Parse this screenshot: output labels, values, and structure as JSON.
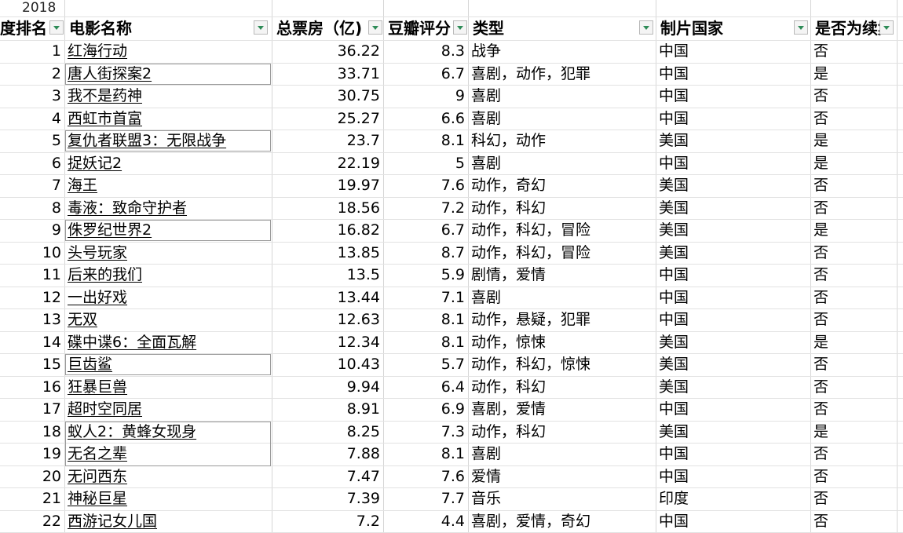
{
  "year_label": "2018",
  "headers": [
    "度排名",
    "电影名称",
    "总票房（亿)",
    "豆瓣评分",
    "类型",
    "制片国家",
    "是否为续集"
  ],
  "rows": [
    {
      "rank": "1",
      "name": "红海行动",
      "box_office": "36.22",
      "rating": "8.3",
      "genre": "战争",
      "country": "中国",
      "sequel": "否"
    },
    {
      "rank": "2",
      "name": "唐人街探案2",
      "box_office": "33.71",
      "rating": "6.7",
      "genre": "喜剧，动作，犯罪",
      "country": "中国",
      "sequel": "是"
    },
    {
      "rank": "3",
      "name": "我不是药神",
      "box_office": "30.75",
      "rating": "9",
      "genre": "喜剧",
      "country": "中国",
      "sequel": "否"
    },
    {
      "rank": "4",
      "name": "西虹市首富",
      "box_office": "25.27",
      "rating": "6.6",
      "genre": "喜剧",
      "country": "中国",
      "sequel": "否"
    },
    {
      "rank": "5",
      "name": "复仇者联盟3：无限战争",
      "box_office": "23.7",
      "rating": "8.1",
      "genre": "科幻，动作",
      "country": "美国",
      "sequel": "是"
    },
    {
      "rank": "6",
      "name": "捉妖记2",
      "box_office": "22.19",
      "rating": "5",
      "genre": "喜剧",
      "country": "中国",
      "sequel": "是"
    },
    {
      "rank": "7",
      "name": "海王",
      "box_office": "19.97",
      "rating": "7.6",
      "genre": "动作，奇幻",
      "country": "美国",
      "sequel": "否"
    },
    {
      "rank": "8",
      "name": "毒液：致命守护者",
      "box_office": "18.56",
      "rating": "7.2",
      "genre": "动作，科幻",
      "country": "美国",
      "sequel": "否"
    },
    {
      "rank": "9",
      "name": "侏罗纪世界2",
      "box_office": "16.82",
      "rating": "6.7",
      "genre": "动作，科幻，冒险",
      "country": "美国",
      "sequel": "是"
    },
    {
      "rank": "10",
      "name": "头号玩家",
      "box_office": "13.85",
      "rating": "8.7",
      "genre": "动作，科幻，冒险",
      "country": "美国",
      "sequel": "否"
    },
    {
      "rank": "11",
      "name": "后来的我们",
      "box_office": "13.5",
      "rating": "5.9",
      "genre": "剧情，爱情",
      "country": "中国",
      "sequel": "否"
    },
    {
      "rank": "12",
      "name": "一出好戏",
      "box_office": "13.44",
      "rating": "7.1",
      "genre": "喜剧",
      "country": "中国",
      "sequel": "否"
    },
    {
      "rank": "13",
      "name": "无双",
      "box_office": "12.63",
      "rating": "8.1",
      "genre": "动作，悬疑，犯罪",
      "country": "中国",
      "sequel": "否"
    },
    {
      "rank": "14",
      "name": "碟中谍6：全面瓦解",
      "box_office": "12.34",
      "rating": "8.1",
      "genre": "动作，惊悚",
      "country": "美国",
      "sequel": "是"
    },
    {
      "rank": "15",
      "name": "巨齿鲨",
      "box_office": "10.43",
      "rating": "5.7",
      "genre": "动作，科幻，惊悚",
      "country": "美国",
      "sequel": "否"
    },
    {
      "rank": "16",
      "name": "狂暴巨兽",
      "box_office": "9.94",
      "rating": "6.4",
      "genre": "动作，科幻",
      "country": "美国",
      "sequel": "否"
    },
    {
      "rank": "17",
      "name": "超时空同居",
      "box_office": "8.91",
      "rating": "6.9",
      "genre": "喜剧，爱情",
      "country": "中国",
      "sequel": "否"
    },
    {
      "rank": "18",
      "name": "蚁人2：黄蜂女现身",
      "box_office": "8.25",
      "rating": "7.3",
      "genre": "动作，科幻",
      "country": "美国",
      "sequel": "是"
    },
    {
      "rank": "19",
      "name": "无名之辈",
      "box_office": "7.88",
      "rating": "8.1",
      "genre": "喜剧",
      "country": "中国",
      "sequel": "否"
    },
    {
      "rank": "20",
      "name": "无问西东",
      "box_office": "7.47",
      "rating": "7.6",
      "genre": "爱情",
      "country": "中国",
      "sequel": "否"
    },
    {
      "rank": "21",
      "name": "神秘巨星",
      "box_office": "7.39",
      "rating": "7.7",
      "genre": "音乐",
      "country": "印度",
      "sequel": "否"
    },
    {
      "rank": "22",
      "name": "西游记女儿国",
      "box_office": "7.2",
      "rating": "4.4",
      "genre": "喜剧，爱情，奇幻",
      "country": "中国",
      "sequel": "否"
    }
  ]
}
